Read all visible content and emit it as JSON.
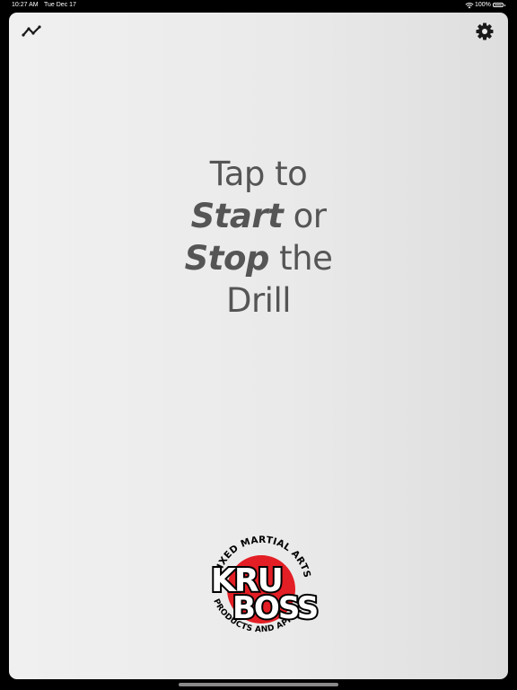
{
  "status_bar": {
    "time": "10:27 AM",
    "date": "Tue Dec 17",
    "battery_percent": "100%",
    "battery_level": 1.0,
    "wifi_icon": "wifi-icon",
    "battery_icon": "battery-icon"
  },
  "toolbar": {
    "stats_icon": "line-chart-icon",
    "settings_icon": "gear-icon"
  },
  "prompt": {
    "line1": "Tap to",
    "start_word": "Start",
    "or_word": " or",
    "stop_word": "Stop",
    "the_word": " the",
    "line4": "Drill"
  },
  "logo": {
    "top_text": "MIXED MARTIAL ARTS",
    "brand_line1": "KRU",
    "brand_line2": "BOSS",
    "bottom_text": "PRODUCTS AND APPAREL",
    "circle_color": "#e31e24",
    "text_color": "#000000"
  },
  "colors": {
    "background": "#ececec",
    "prompt_text": "#555555",
    "icon": "#1a1a1a"
  }
}
